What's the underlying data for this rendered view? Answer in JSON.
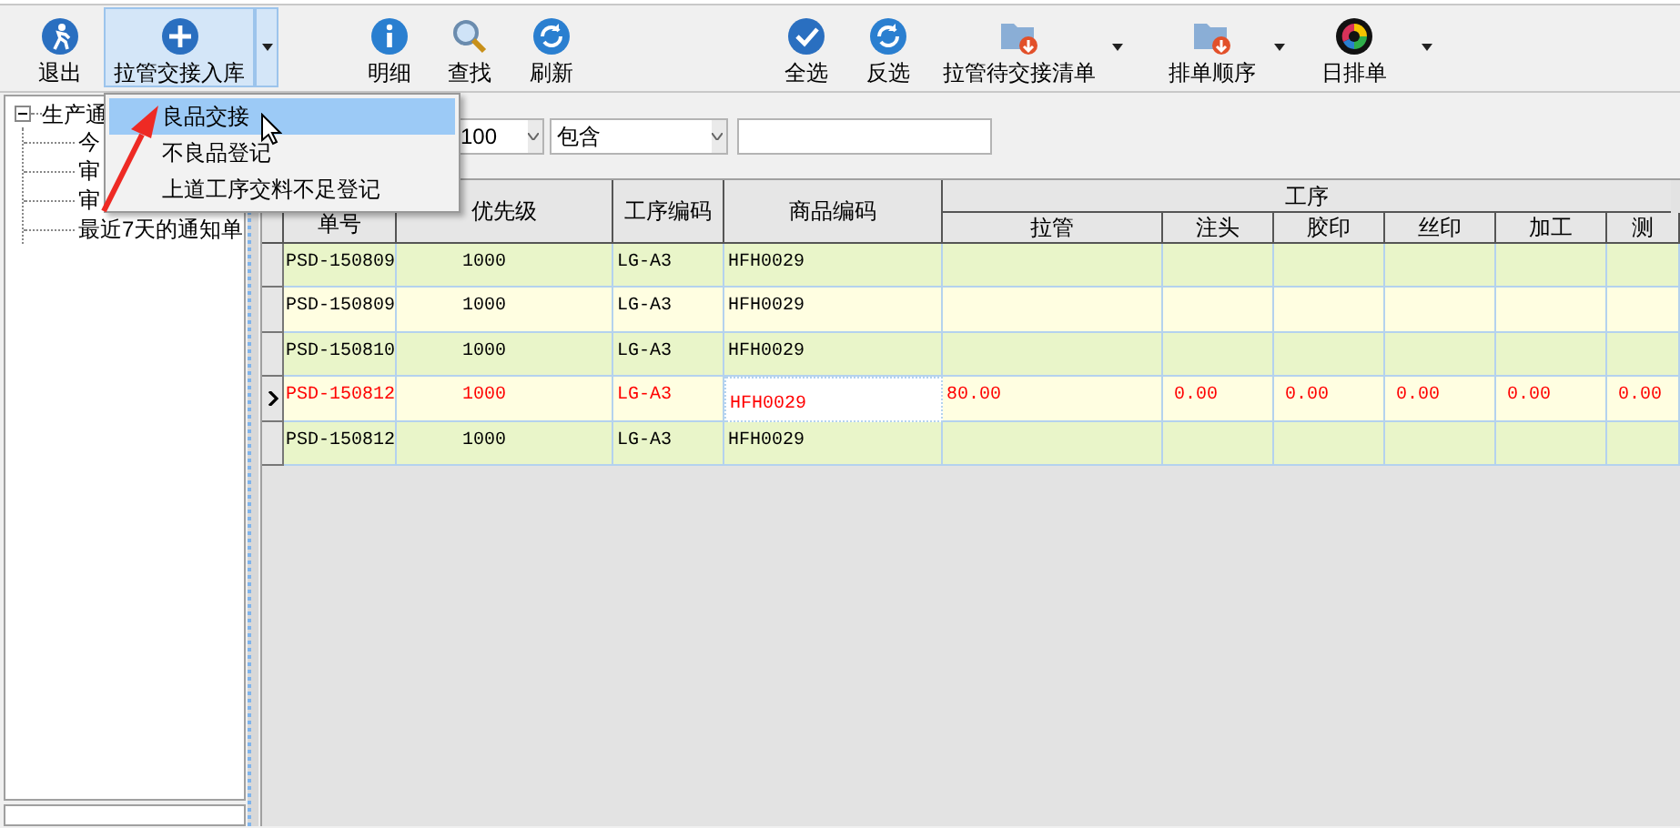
{
  "toolbar": {
    "buttons": [
      {
        "label": "退出",
        "kind": "plain",
        "pressed": false
      },
      {
        "label": "拉管交接入库",
        "kind": "split",
        "pressed": true
      },
      {
        "label": "明细",
        "kind": "plain",
        "pressed": false
      },
      {
        "label": "查找",
        "kind": "plain",
        "pressed": false
      },
      {
        "label": "刷新",
        "kind": "plain",
        "pressed": false
      },
      {
        "label": "全选",
        "kind": "plain",
        "pressed": false
      },
      {
        "label": "反选",
        "kind": "plain",
        "pressed": false
      },
      {
        "label": "拉管待交接清单",
        "kind": "split",
        "pressed": false
      },
      {
        "label": "排单顺序",
        "kind": "split",
        "pressed": false
      },
      {
        "label": "日排单",
        "kind": "split",
        "pressed": false
      }
    ]
  },
  "dropdown_menu": {
    "items": [
      {
        "label": "良品交接",
        "selected": true
      },
      {
        "label": "不良品登记",
        "selected": false
      },
      {
        "label": "上道工序交料不足登记",
        "selected": false
      }
    ]
  },
  "tree": {
    "label": "生产通",
    "expanded": true,
    "children": [
      {
        "label": "今"
      },
      {
        "label": "审"
      },
      {
        "label": "审"
      },
      {
        "label": "最近7天的通知单"
      }
    ]
  },
  "filter": {
    "count": "100",
    "match": "包含"
  },
  "table": {
    "group_header": "工序",
    "columns": [
      {
        "label": "单号",
        "group": false,
        "focused": false
      },
      {
        "label": "优先级",
        "group": false,
        "focused": false
      },
      {
        "label": "工序编码",
        "group": false,
        "focused": false
      },
      {
        "label": "商品编码",
        "group": false,
        "focused": true
      },
      {
        "label": "拉管",
        "group": true,
        "focused": false
      },
      {
        "label": "注头",
        "group": true,
        "focused": false
      },
      {
        "label": "胶印",
        "group": true,
        "focused": false
      },
      {
        "label": "丝印",
        "group": true,
        "focused": false
      },
      {
        "label": "加工",
        "group": true,
        "focused": false
      },
      {
        "label": "测",
        "group": true,
        "focused": false
      }
    ],
    "rows": [
      {
        "current": false,
        "cells": [
          "PSD-150809",
          "1000",
          "LG-A3",
          "HFH0029"
        ]
      },
      {
        "current": false,
        "cells": [
          "PSD-150809",
          "1000",
          "LG-A3",
          "HFH0029"
        ]
      },
      {
        "current": false,
        "cells": [
          "PSD-150810",
          "1000",
          "LG-A3",
          "HFH0029"
        ]
      },
      {
        "current": true,
        "cells": [
          "PSD-150812",
          "1000",
          "LG-A3",
          "HFH0029",
          "80.00",
          "0.00",
          "0.00",
          "0.00",
          "0.00",
          "0.00"
        ]
      },
      {
        "current": false,
        "cells": [
          "PSD-150812",
          "1000",
          "LG-A3",
          "HFH0029"
        ]
      }
    ]
  }
}
